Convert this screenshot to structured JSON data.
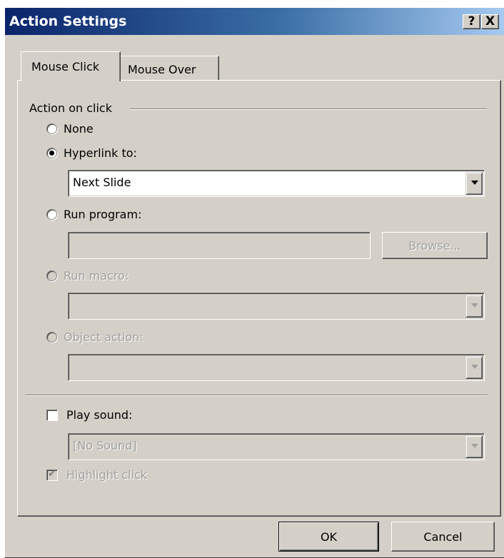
{
  "window": {
    "title": "Action Settings",
    "help_button": "?",
    "close_button": "X"
  },
  "tabs": [
    {
      "label": "Mouse Click",
      "selected": true
    },
    {
      "label": "Mouse Over",
      "selected": false
    }
  ],
  "group": {
    "label": "Action on click"
  },
  "options": {
    "none": {
      "label": "None",
      "checked": false,
      "enabled": true
    },
    "hyperlink": {
      "label": "Hyperlink to:",
      "checked": true,
      "enabled": true,
      "value": "Next Slide"
    },
    "run_program": {
      "label": "Run program:",
      "checked": false,
      "enabled": true,
      "value": "",
      "browse_label": "Browse..."
    },
    "run_macro": {
      "label": "Run macro:",
      "checked": false,
      "enabled": false,
      "value": ""
    },
    "object_action": {
      "label": "Object action:",
      "checked": false,
      "enabled": false,
      "value": ""
    }
  },
  "play_sound": {
    "label": "Play sound:",
    "checked": false,
    "value": "[No Sound]"
  },
  "highlight_click": {
    "label": "Highlight click",
    "checked": true,
    "enabled": false
  },
  "buttons": {
    "ok": "OK",
    "cancel": "Cancel"
  },
  "colors": {
    "face": "#d4d0c8",
    "title_start": "#0a246a",
    "title_end": "#a6caf0"
  }
}
